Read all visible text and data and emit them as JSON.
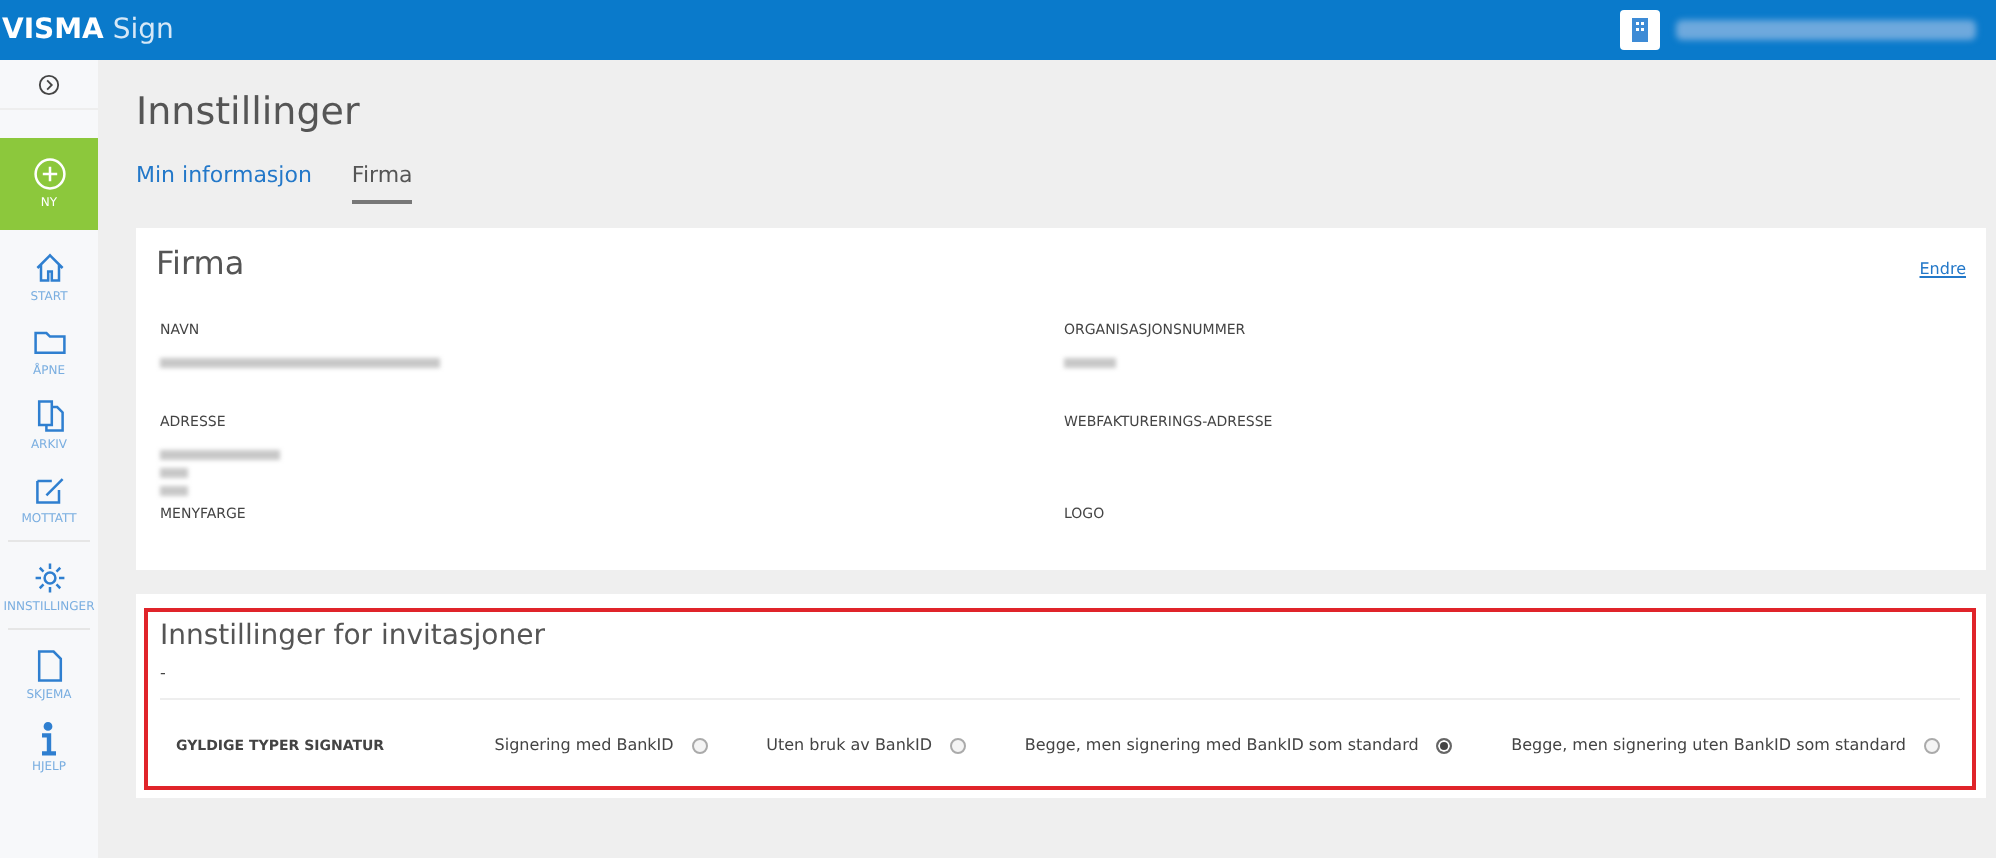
{
  "header": {
    "brand": "VISMA",
    "product": "Sign"
  },
  "sidebar": {
    "items": [
      {
        "kind": "new",
        "label": "NY",
        "selected": true
      },
      {
        "kind": "home",
        "label": "START",
        "selected": false
      },
      {
        "kind": "folder",
        "label": "ÅPNE",
        "selected": false
      },
      {
        "kind": "archive",
        "label": "ARKIV",
        "selected": false
      },
      {
        "kind": "edit",
        "label": "MOTTATT",
        "selected": false
      },
      {
        "kind": "settings",
        "label": "INNSTILLINGER",
        "selected": false
      },
      {
        "kind": "document",
        "label": "SKJEMA",
        "selected": false
      },
      {
        "kind": "info",
        "label": "HJELP",
        "selected": false
      }
    ]
  },
  "page": {
    "title": "Innstillinger",
    "tabs": [
      {
        "label": "Min informasjon",
        "selected": false
      },
      {
        "label": "Firma",
        "selected": true
      }
    ]
  },
  "company_card": {
    "title": "Firma",
    "edit_link": "Endre",
    "fields": [
      {
        "label": "NAVN"
      },
      {
        "label": "ORGANISASJONSNUMMER"
      },
      {
        "label": "ADRESSE"
      },
      {
        "label": "WEBFAKTURERINGS-ADRESSE"
      },
      {
        "label": "MENYFARGE"
      },
      {
        "label": "LOGO"
      }
    ]
  },
  "invitation_card": {
    "title": "Innstillinger for invitasjoner",
    "note": "-",
    "highlighted": true,
    "setting_label": "GYLDIGE TYPER SIGNATUR",
    "options": [
      {
        "label": "Signering med BankID",
        "selected": false
      },
      {
        "label": "Uten bruk av BankID",
        "selected": false
      },
      {
        "label": "Begge, men signering med BankID som standard",
        "selected": true
      },
      {
        "label": "Begge, men signering uten BankID som standard",
        "selected": false
      }
    ]
  }
}
